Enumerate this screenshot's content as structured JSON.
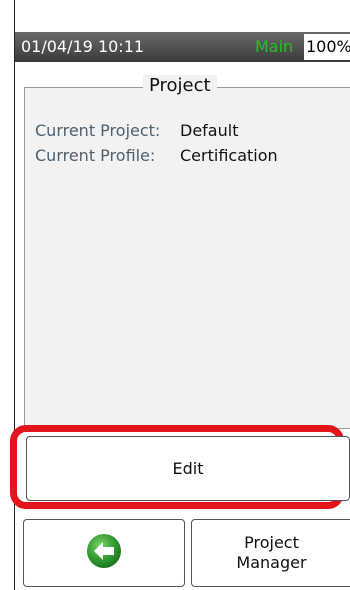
{
  "status_bar": {
    "datetime": "01/04/19 10:11",
    "mode": "Main",
    "battery": "100%",
    "mode_color": "#22c322"
  },
  "panel": {
    "title": "Project",
    "rows": [
      {
        "label": "Current Project:",
        "value": "Default"
      },
      {
        "label": "Current Profile:",
        "value": "Certification"
      }
    ]
  },
  "buttons": {
    "edit_label": "Edit",
    "back_icon": "back-arrow-icon",
    "project_manager_line1": "Project",
    "project_manager_line2": "Manager"
  },
  "colors": {
    "highlight": "#e3141b",
    "back_icon_green": "#2f9a2f"
  }
}
